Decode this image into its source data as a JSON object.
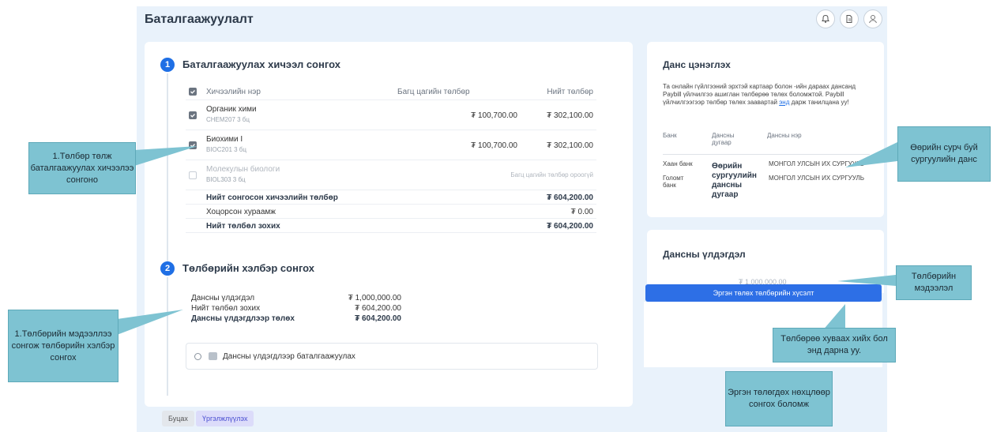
{
  "header": {
    "title": "Баталгаажуулалт",
    "icons": [
      "bell-icon",
      "document-icon",
      "user-avatar-icon"
    ]
  },
  "section1": {
    "step": "1",
    "title": "Баталгаажуулах хичээл сонгох",
    "columns": [
      "Хичээлийн нэр",
      "Багц цагийн төлбөр",
      "Нийт төлбөр"
    ],
    "rows": [
      {
        "name": "Органик хими",
        "code": "CHEM207  3 бц",
        "unit": "₮ 100,700.00",
        "total": "₮ 302,100.00",
        "checked": true
      },
      {
        "name": "Биохими I",
        "code": "BIOC201  3 бц",
        "unit": "₮ 100,700.00",
        "total": "₮ 302,100.00",
        "checked": true
      },
      {
        "name": "Молекулын биологи",
        "code": "BIOL303  3 бц",
        "unit": "",
        "total": "Багц цагийн төлбөр ороогүй",
        "checked": false
      }
    ],
    "summary": [
      {
        "label": "Нийт сонгосон хичээлийн төлбөр",
        "value": "₮ 604,200.00"
      },
      {
        "label": "Хоцорсон хураамж",
        "value": "₮ 0.00"
      },
      {
        "label": "Нийт төлбөл зохих",
        "value": "₮ 604,200.00"
      }
    ]
  },
  "section2": {
    "step": "2",
    "title": "Төлбөрийн хэлбэр сонгох",
    "info": [
      {
        "label": "Дансны үлдэгдэл",
        "value": "₮ 1,000,000.00"
      },
      {
        "label": "Нийт төлбөл зохих",
        "value": "₮ 604,200.00"
      },
      {
        "label": "Дансны үлдэгдлээр төлөх",
        "value": "₮ 604,200.00"
      }
    ],
    "option_label": "Дансны үлдэгдлээр баталгаажуулах"
  },
  "buttons": {
    "back": "Буцах",
    "next": "Үргэлжлүүлэх"
  },
  "account_card": {
    "title": "Данс цэнэглэх",
    "desc_before_link": "Та онлайн гүйлгээний эрхтэй картаар болон -ийн дараах дансанд Paybill үйлчилгээ ашиглан төлбөрөө төлөх боломжтой. Paybill үйлчилгээгээр төлбөр төлөх заавартай ",
    "desc_link": "энд",
    "desc_after_link": " дарж танилцана уу!",
    "columns": [
      "Банк",
      "Дансны дугаар",
      "Дансны нэр"
    ],
    "banks": [
      {
        "bank": "Хаан банк",
        "name": "МОНГОЛ УЛСЫН ИХ СУРГУУЛЬ"
      },
      {
        "bank": "Голомт банк",
        "name": "МОНГОЛ УЛСЫН ИХ СУРГУУЛЬ"
      }
    ],
    "account_overlay": "Өөрийн сургуулийн дансны дугаар"
  },
  "balance_card": {
    "title": "Дансны үлдэгдэл",
    "amount": "₮ 1,000,000.00",
    "pay_button": "Эргэн төлөх төлбөрийн хүсэлт"
  },
  "callouts": {
    "c1": "1.Төлбөр төлж баталгаажуулах хичээлээ сонгоно",
    "c2": "1.Төлбөрийн мэдээллээ сонгож төлбөрийн хэлбэр сонгох",
    "c3": "Өөрийн сурч буй сургуулийн данс",
    "c4": "Төлбөрийн мэдээлэл",
    "c5": "Төлбөрөө хуваах хийх бол энд дарна уу.",
    "c6": "Эргэн төлөгдөх нөхцлөөр сонгох боломж"
  }
}
